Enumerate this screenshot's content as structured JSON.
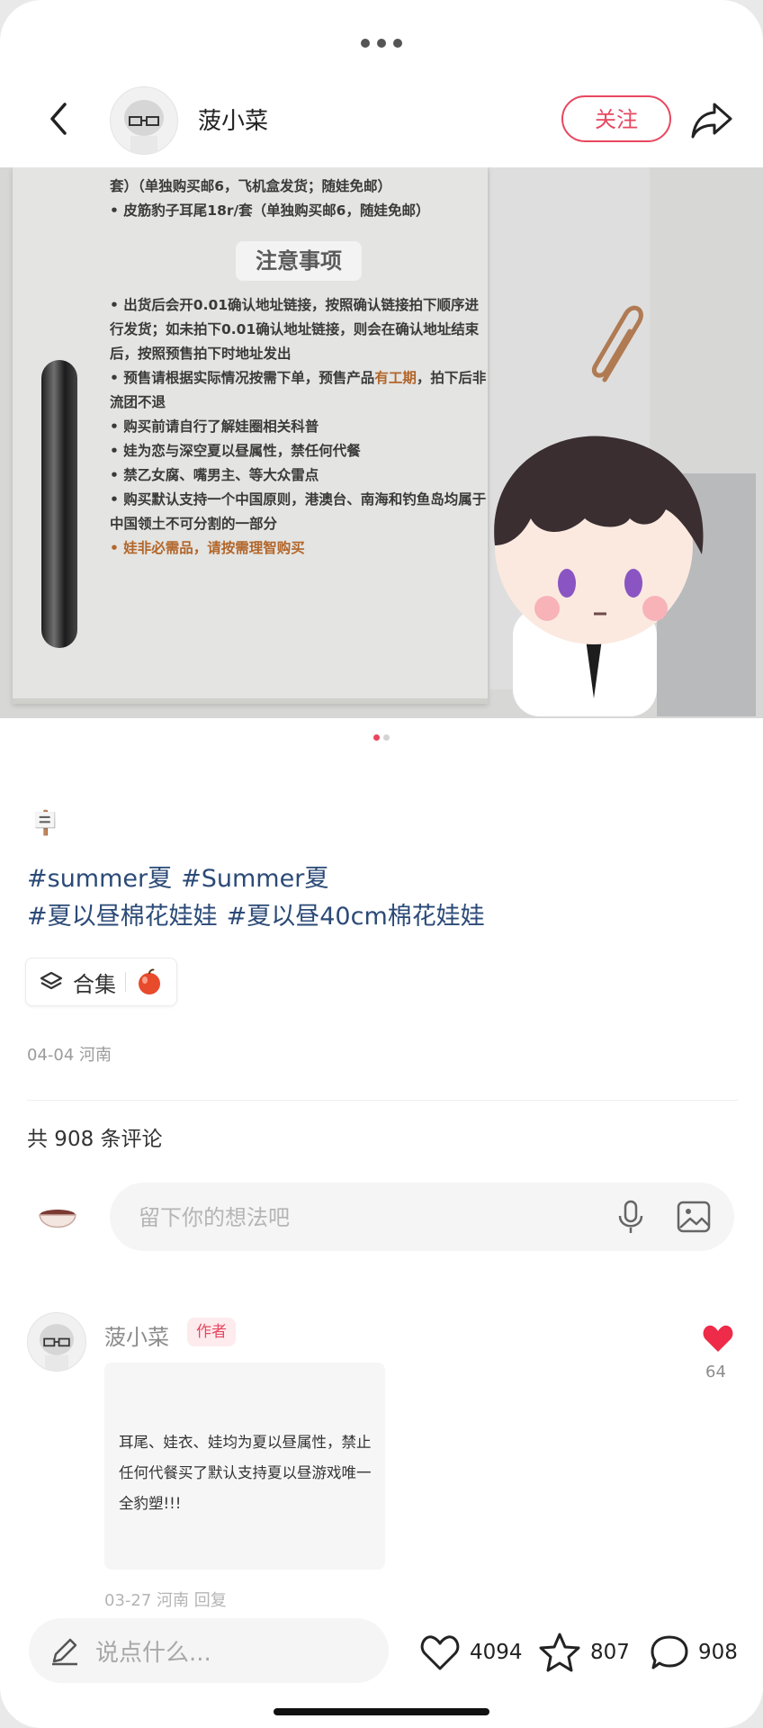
{
  "post": {
    "author_name": "菠小菜",
    "follow_label": "关注",
    "image_notes": {
      "top_line_1": "套）（单独购买邮6，飞机盒发货；随娃免邮）",
      "top_line_2": "• 皮筋豹子耳尾18r/套（单独购买邮6，随娃免邮）",
      "title": "注意事项",
      "items": [
        "• 出货后会开0.01确认地址链接，按照确认链接拍下顺序进行发货；如未拍下0.01确认地址链接，则会在确认地址结束后，按照预售拍下时地址发出",
        "• 预售请根据实际情况按需下单，预售产品",
        "有工期",
        "，拍下后非流团不退",
        "• 购买前请自行了解娃圈相关科普",
        "• 娃为恋与深空夏以昼属性，禁任何代餐",
        "• 禁乙女腐、嘴男主、等大众雷点",
        "• 购买默认支持一个中国原则，港澳台、南海和钓鱼岛均属于中国领土不可分割的一部分",
        "• 娃非必需品，请按需理智购买"
      ]
    },
    "tags": [
      "#summer夏",
      "#Summer夏",
      "#夏以昼棉花娃娃",
      "#夏以昼40cm棉花娃娃"
    ],
    "collection_label": "合集",
    "date_location": "04-04 河南"
  },
  "comments": {
    "count_text": "共 908 条评论",
    "input_placeholder": "留下你的想法吧",
    "items": [
      {
        "name": "菠小菜",
        "badge": "作者",
        "likes": "64",
        "text": "耳尾、娃衣、娃均为夏以昼属性，禁止任何代餐买了默认支持夏以昼游戏唯一全豹塑!!!",
        "date": "03-27 河南  回复"
      }
    ]
  },
  "bottom_bar": {
    "say_placeholder": "说点什么...",
    "likes": "4094",
    "stars": "807",
    "comments": "908"
  },
  "colors": {
    "accent": "#e8475f",
    "tag_blue": "#2b4a77"
  }
}
